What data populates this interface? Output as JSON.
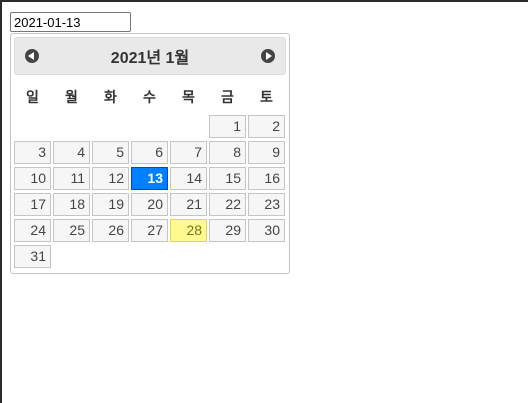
{
  "date_input": {
    "value": "2021-01-13"
  },
  "datepicker": {
    "title": "2021년 1월",
    "prev_icon": "circle-triangle-left-icon",
    "next_icon": "circle-triangle-right-icon",
    "weekdays": [
      "일",
      "월",
      "화",
      "수",
      "목",
      "금",
      "토"
    ],
    "weeks": [
      [
        "",
        "",
        "",
        "",
        "",
        "1",
        "2"
      ],
      [
        "3",
        "4",
        "5",
        "6",
        "7",
        "8",
        "9"
      ],
      [
        "10",
        "11",
        "12",
        "13",
        "14",
        "15",
        "16"
      ],
      [
        "17",
        "18",
        "19",
        "20",
        "21",
        "22",
        "23"
      ],
      [
        "24",
        "25",
        "26",
        "27",
        "28",
        "29",
        "30"
      ],
      [
        "31",
        "",
        "",
        "",
        "",
        "",
        ""
      ]
    ],
    "selected_day": "13",
    "today_day": "28",
    "colors": {
      "selected_bg": "#007fff",
      "today_bg": "#fffa90",
      "header_bg": "#e9e9e9"
    }
  }
}
